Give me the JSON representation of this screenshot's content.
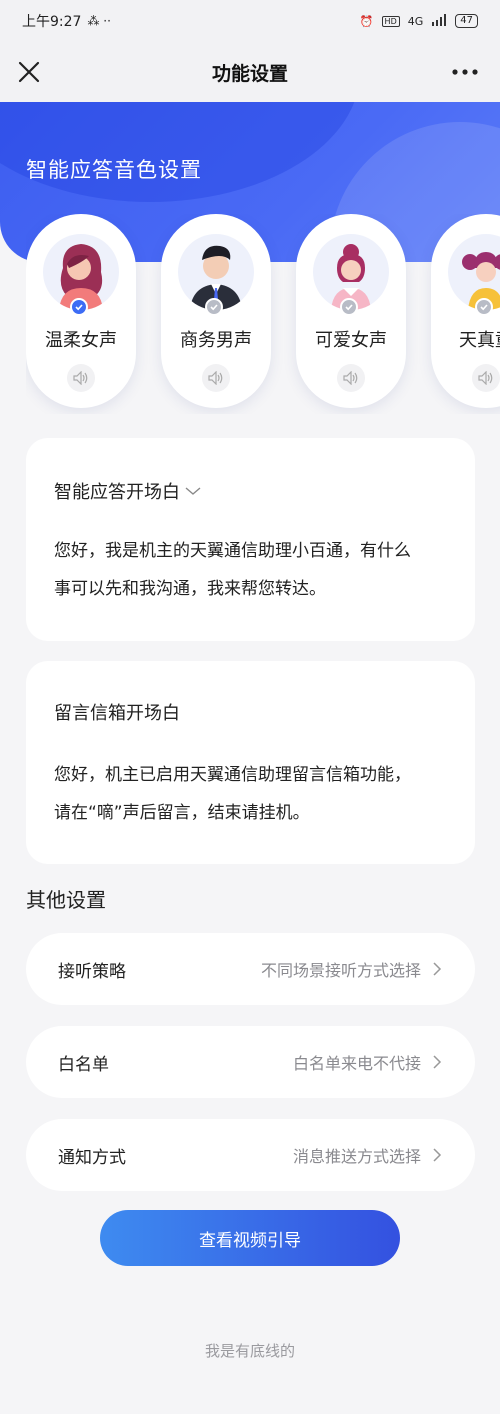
{
  "status_bar": {
    "time": "上午9:27",
    "extra": "⁂ ··",
    "network": "4G",
    "battery": "47"
  },
  "nav": {
    "title": "功能设置"
  },
  "hero": {
    "title": "智能应答音色设置"
  },
  "voices": [
    {
      "name": "温柔女声",
      "selected": true
    },
    {
      "name": "商务男声",
      "selected": false
    },
    {
      "name": "可爱女声",
      "selected": false
    },
    {
      "name": "天真童",
      "selected": false
    }
  ],
  "greeting_card": {
    "title": "智能应答开场白",
    "line1": "您好，我是机主的天翼通信助理小百通，有什么",
    "line2": "事可以先和我沟通，我来帮您转达。"
  },
  "voicemail_card": {
    "title": "留言信箱开场白",
    "line1": "您好，机主已启用天翼通信助理留言信箱功能，",
    "line2": "请在“嘀”声后留言，结束请挂机。"
  },
  "other_settings": {
    "title": "其他设置",
    "rows": [
      {
        "label": "接听策略",
        "value": "不同场景接听方式选择"
      },
      {
        "label": "白名单",
        "value": "白名单来电不代接"
      },
      {
        "label": "通知方式",
        "value": "消息推送方式选择"
      }
    ]
  },
  "cta": {
    "label": "查看视频引导"
  },
  "footer": {
    "text": "我是有底线的"
  },
  "colors": {
    "brand_blue": "#3d5ef0",
    "check_selected": "#3d6cf5",
    "check_default": "#b8bcc6"
  }
}
